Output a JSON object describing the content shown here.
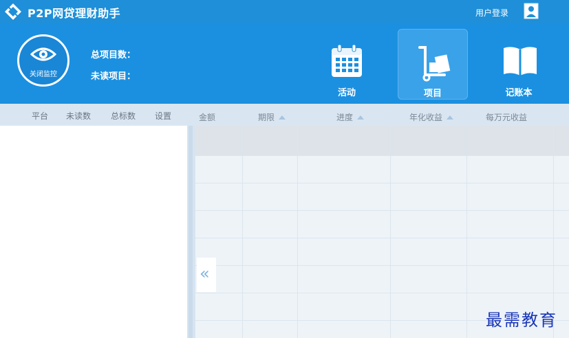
{
  "app": {
    "title": "P2P网贷理财助手",
    "login_label": "用户登录"
  },
  "header": {
    "monitor_label": "关闭监控",
    "stats": [
      {
        "label": "总项目数："
      },
      {
        "label": "未读项目："
      }
    ],
    "nav": [
      {
        "label": "活动",
        "icon": "calendar-icon"
      },
      {
        "label": "项目",
        "icon": "trolley-icon",
        "active": true
      },
      {
        "label": "记账本",
        "icon": "book-icon"
      }
    ]
  },
  "left_panel": {
    "columns": [
      "平台",
      "未读数",
      "总标数",
      "设置"
    ]
  },
  "table": {
    "columns": [
      "金额",
      "期限",
      "进度",
      "年化收益",
      "每万元收益"
    ]
  },
  "watermark": "最需教育",
  "colors": {
    "primary": "#1b90e0",
    "titlebar": "#1e8fd8",
    "header_bg": "#d9e6f2"
  }
}
